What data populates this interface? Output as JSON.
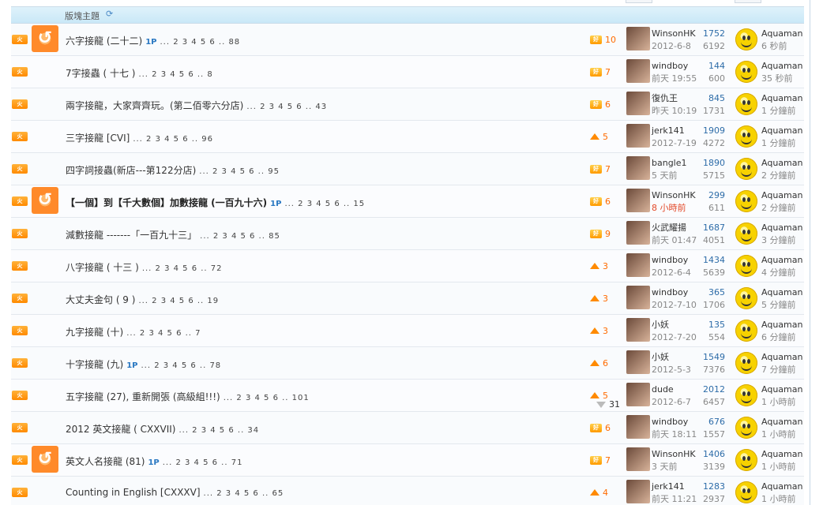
{
  "section": {
    "title": "版塊主題",
    "refresh_icon": "refresh-icon"
  },
  "badge_labels": {
    "new": "火",
    "hot": "好"
  },
  "rows": [
    {
      "title": "六字接龍 (二十二)",
      "onep": "1P",
      "pages": "... 2 3 4 5 6 .. 88",
      "vote": "10",
      "vote_type": "hot",
      "has_avatar": true,
      "author": "WinsonHK",
      "date": "2012-6-8",
      "date_red": false,
      "replies": "1752",
      "views": "6192",
      "last_user": "Aquaman",
      "last_time": "6 秒前",
      "bold": false
    },
    {
      "title": "7字接蟲 ( 十七 )",
      "onep": "",
      "pages": "... 2 3 4 5 6 .. 8",
      "vote": "7",
      "vote_type": "hot",
      "has_avatar": false,
      "author": "windboy",
      "date": "前天 19:55",
      "date_red": false,
      "replies": "144",
      "views": "600",
      "last_user": "Aquaman",
      "last_time": "35 秒前",
      "bold": false
    },
    {
      "title": "兩字接龍，大家齊齊玩。(第二佰零六分店)",
      "onep": "",
      "pages": "... 2 3 4 5 6 .. 43",
      "vote": "6",
      "vote_type": "hot",
      "has_avatar": false,
      "author": "復仇王",
      "date": "昨天 10:19",
      "date_red": false,
      "replies": "845",
      "views": "1731",
      "last_user": "Aquaman",
      "last_time": "1 分鐘前",
      "bold": false
    },
    {
      "title": "三字接龍 [CVI]",
      "onep": "",
      "pages": "... 2 3 4 5 6 .. 96",
      "vote": "5",
      "vote_type": "up",
      "has_avatar": false,
      "author": "jerk141",
      "date": "2012-7-19",
      "date_red": false,
      "replies": "1909",
      "views": "4272",
      "last_user": "Aquaman",
      "last_time": "1 分鐘前",
      "bold": false
    },
    {
      "title": "四字詞接蟲(新店---第122分店)",
      "onep": "",
      "pages": "... 2 3 4 5 6 .. 95",
      "vote": "7",
      "vote_type": "hot",
      "has_avatar": false,
      "author": "bangle1",
      "date": "5 天前",
      "date_red": false,
      "replies": "1890",
      "views": "5715",
      "last_user": "Aquaman",
      "last_time": "2 分鐘前",
      "bold": false
    },
    {
      "title": "【一個】到【千大數個】加數接龍 (一百九十六)",
      "onep": "1P",
      "pages": "... 2 3 4 5 6 .. 15",
      "vote": "6",
      "vote_type": "hot",
      "has_avatar": true,
      "author": "WinsonHK",
      "date": "8 小時前",
      "date_red": true,
      "replies": "299",
      "views": "611",
      "last_user": "Aquaman",
      "last_time": "2 分鐘前",
      "bold": true
    },
    {
      "title": "減數接龍 -------「一百九十三」",
      "onep": "",
      "pages": "... 2 3 4 5 6 .. 85",
      "vote": "9",
      "vote_type": "hot",
      "has_avatar": false,
      "author": "火武耀揚",
      "date": "前天 01:47",
      "date_red": false,
      "replies": "1687",
      "views": "4051",
      "last_user": "Aquaman",
      "last_time": "3 分鐘前",
      "bold": false
    },
    {
      "title": "八字接龍 ( 十三 )",
      "onep": "",
      "pages": "... 2 3 4 5 6 .. 72",
      "vote": "3",
      "vote_type": "up",
      "has_avatar": false,
      "author": "windboy",
      "date": "2012-6-4",
      "date_red": false,
      "replies": "1434",
      "views": "5639",
      "last_user": "Aquaman",
      "last_time": "4 分鐘前",
      "bold": false
    },
    {
      "title": "大丈夫金句 ( 9 )",
      "onep": "",
      "pages": "... 2 3 4 5 6 .. 19",
      "vote": "3",
      "vote_type": "up",
      "has_avatar": false,
      "author": "windboy",
      "date": "2012-7-10",
      "date_red": false,
      "replies": "365",
      "views": "1706",
      "last_user": "Aquaman",
      "last_time": "5 分鐘前",
      "bold": false
    },
    {
      "title": "九字接龍 (十)",
      "onep": "",
      "pages": "... 2 3 4 5 6 .. 7",
      "vote": "3",
      "vote_type": "up",
      "has_avatar": false,
      "author": "小妖",
      "date": "2012-7-20",
      "date_red": false,
      "replies": "135",
      "views": "554",
      "last_user": "Aquaman",
      "last_time": "6 分鐘前",
      "bold": false
    },
    {
      "title": "十字接龍 (九)",
      "onep": "1P",
      "pages": "... 2 3 4 5 6 .. 78",
      "vote": "6",
      "vote_type": "up",
      "has_avatar": false,
      "author": "小妖",
      "date": "2012-5-3",
      "date_red": false,
      "replies": "1549",
      "views": "7376",
      "last_user": "Aquaman",
      "last_time": "7 分鐘前",
      "bold": false
    },
    {
      "title": "五字接龍 (27), 重新開張 (高級組!!!)",
      "onep": "",
      "pages": "... 2 3 4 5 6 .. 101",
      "vote": "5",
      "vote_type": "up",
      "vote_down": "31",
      "has_avatar": false,
      "author": "dude",
      "date": "2012-6-7",
      "date_red": false,
      "replies": "2012",
      "views": "6457",
      "last_user": "Aquaman",
      "last_time": "1 小時前",
      "bold": false
    },
    {
      "title": "2012 英文接龍 ( CXXVII)",
      "onep": "",
      "pages": "... 2 3 4 5 6 .. 34",
      "vote": "6",
      "vote_type": "hot",
      "has_avatar": false,
      "author": "windboy",
      "date": "前天 18:11",
      "date_red": false,
      "replies": "676",
      "views": "1557",
      "last_user": "Aquaman",
      "last_time": "1 小時前",
      "bold": false
    },
    {
      "title": "英文人名接龍 (81)",
      "onep": "1P",
      "pages": "... 2 3 4 5 6 .. 71",
      "vote": "7",
      "vote_type": "hot",
      "has_avatar": true,
      "author": "WinsonHK",
      "date": "3 天前",
      "date_red": false,
      "replies": "1406",
      "views": "3139",
      "last_user": "Aquaman",
      "last_time": "1 小時前",
      "bold": false
    },
    {
      "title": "Counting in English [CXXXV]",
      "onep": "",
      "pages": "... 2 3 4 5 6 .. 65",
      "vote": "4",
      "vote_type": "up",
      "has_avatar": false,
      "author": "jerk141",
      "date": "前天 11:21",
      "date_red": false,
      "replies": "1283",
      "views": "2937",
      "last_user": "Aquaman",
      "last_time": "1 小時前",
      "bold": false
    }
  ]
}
